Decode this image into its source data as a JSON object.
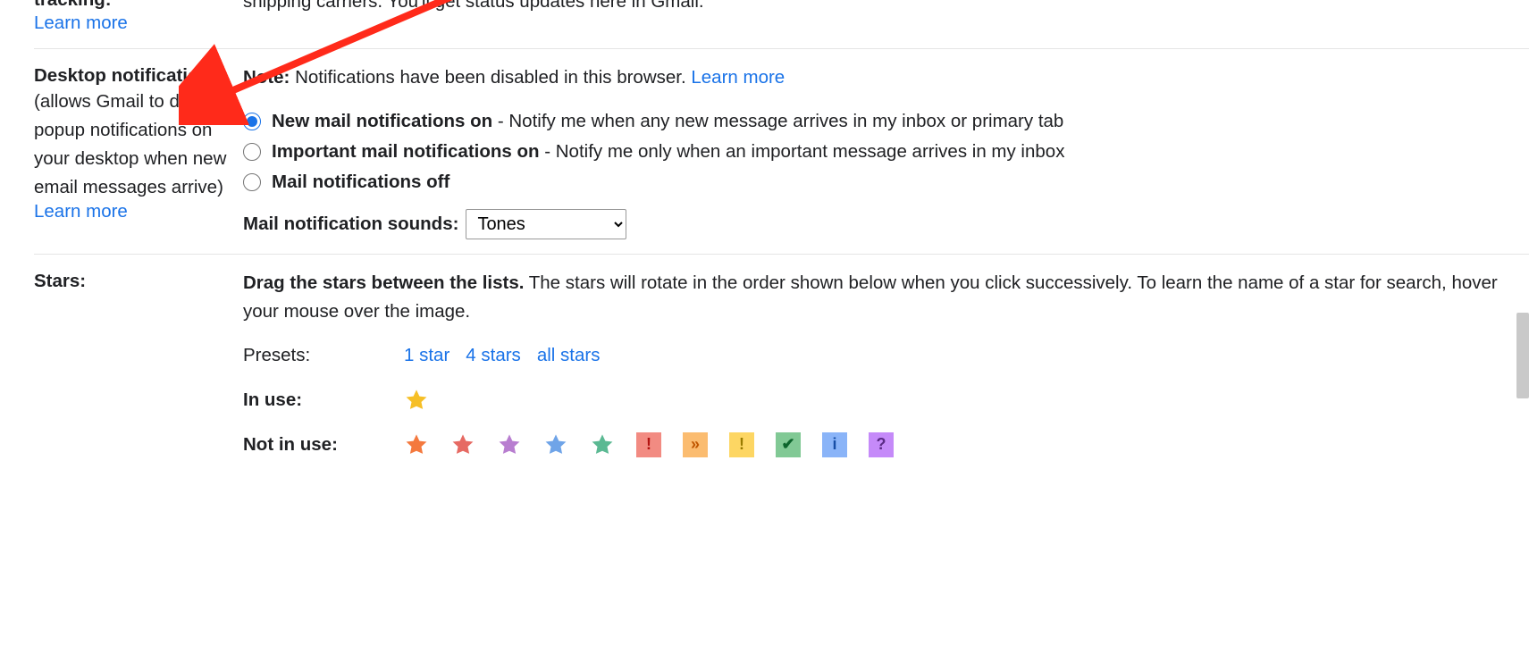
{
  "package": {
    "title_line2": "tracking:",
    "learn_more": "Learn more",
    "desc_line2": "shipping carriers. You'll get status updates here in Gmail."
  },
  "desktop": {
    "title": "Desktop notifications:",
    "sub": "(allows Gmail to display popup notifications on your desktop when new email messages arrive)",
    "learn_more": "Learn more",
    "note_label": "Note:",
    "note_text": " Notifications have been disabled in this browser.  ",
    "note_link": "Learn more",
    "radio1_bold": "New mail notifications on ",
    "radio1_rest": "- Notify me when any new message arrives in my inbox or primary tab",
    "radio2_bold": "Important mail notifications on ",
    "radio2_rest": "- Notify me only when an important message arrives in my inbox",
    "radio3_bold": "Mail notifications off",
    "sounds_label": "Mail notification sounds: ",
    "sounds_value": "Tones"
  },
  "stars": {
    "title": "Stars:",
    "drag_bold": "Drag the stars between the lists.",
    "drag_rest": "  The stars will rotate in the order shown below when you click successively. To learn the name of a star for search, hover your mouse over the image.",
    "presets_label": "Presets:",
    "preset_1": "1 star",
    "preset_4": "4 stars",
    "preset_all": "all stars",
    "in_use_label": "In use:",
    "not_in_use_label": "Not in use:"
  },
  "icons": {
    "star_yellow": "#f6bf26",
    "star_orange": "#f4793e",
    "star_red": "#e66a63",
    "star_purple": "#b87ed0",
    "star_blue": "#6fa4e8",
    "star_green": "#5bb993",
    "badge_red_bang": {
      "bg": "#f28b82",
      "fg": "#b31412",
      "char": "!"
    },
    "badge_orange_gg": {
      "bg": "#fbbc70",
      "fg": "#c05600",
      "char": "»"
    },
    "badge_yellow_bang": {
      "bg": "#fdd663",
      "fg": "#9a7b00",
      "char": "!"
    },
    "badge_green_check": {
      "bg": "#81c995",
      "fg": "#0d652d",
      "char": "✔"
    },
    "badge_blue_info": {
      "bg": "#8ab4f8",
      "fg": "#174ea6",
      "char": "i"
    },
    "badge_purple_q": {
      "bg": "#c58af9",
      "fg": "#5b2a86",
      "char": "?"
    }
  }
}
